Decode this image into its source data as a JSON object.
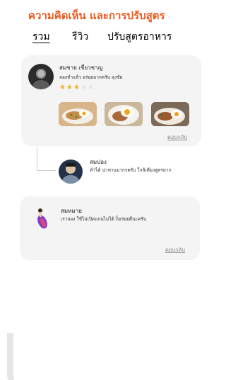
{
  "header": {
    "title": "ความคิดเห็น และการปรับสูตร"
  },
  "tabs": [
    {
      "label": "รวม",
      "active": true
    },
    {
      "label": "รีวิว",
      "active": false
    },
    {
      "label": "ปรับสูตรอาหาร",
      "active": false
    }
  ],
  "reviews": [
    {
      "name": "สมชาย เชี่ยวชาญ",
      "comment": "ลองทำแล้ว อร่อยมากครับ ลุงชัย",
      "rating": 3,
      "rating_max": 5,
      "reply_label": "ตอบกลับ",
      "photos": [
        "food-photo-1",
        "food-photo-2",
        "food-photo-3"
      ]
    },
    {
      "name": "สมหมาย",
      "comment": "เราลอง ใช้ไม่เปิดแกนไม่ได้ ก็อร่อยดีนะครับ",
      "reply_label": "ตอบกลับ"
    }
  ],
  "replies": [
    {
      "name": "สมปอง",
      "comment": "ทำได้ น่าทานมากๆครับ ใกล้เคียงสูตรมาก"
    }
  ],
  "colors": {
    "accent": "#ec5a1f",
    "star_on": "#f2b01e",
    "star_off": "#e3e3e3",
    "card_bg": "#f4f4f4"
  }
}
